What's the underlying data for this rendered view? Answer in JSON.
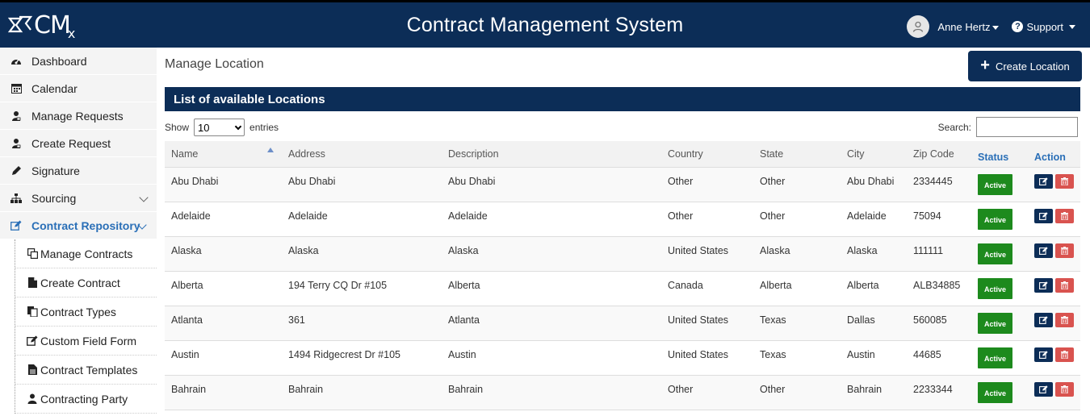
{
  "header": {
    "logo_text": "CM",
    "logo_sub": "x",
    "title": "Contract Management System",
    "user_name": "Anne Hertz",
    "support_label": "Support"
  },
  "sidebar": {
    "items": [
      {
        "label": "Dashboard",
        "icon": "dashboard-icon"
      },
      {
        "label": "Calendar",
        "icon": "calendar-icon"
      },
      {
        "label": "Manage Requests",
        "icon": "user-request-icon"
      },
      {
        "label": "Create Request",
        "icon": "user-request-icon"
      },
      {
        "label": "Signature",
        "icon": "pencil-icon"
      },
      {
        "label": "Sourcing",
        "icon": "sitemap-icon"
      },
      {
        "label": "Contract Repository",
        "icon": "edit-icon"
      }
    ],
    "subitems": [
      {
        "label": "Manage Contracts",
        "icon": "copy-icon"
      },
      {
        "label": "Create Contract",
        "icon": "file-icon"
      },
      {
        "label": "Contract Types",
        "icon": "files-icon"
      },
      {
        "label": "Custom Field Form",
        "icon": "edit-icon"
      },
      {
        "label": "Contract Templates",
        "icon": "file-text-icon"
      },
      {
        "label": "Contracting Party",
        "icon": "user-icon"
      }
    ]
  },
  "main": {
    "page_title": "Manage Location",
    "create_button_label": "Create Location",
    "panel_title": "List of available Locations",
    "show_label": "Show",
    "entries_label": "entries",
    "page_size": "10",
    "search_label": "Search:",
    "search_value": ""
  },
  "table": {
    "columns": [
      "Name",
      "Address",
      "Description",
      "Country",
      "State",
      "City",
      "Zip Code",
      "Status",
      "Action"
    ],
    "rows": [
      {
        "name": "Abu Dhabi",
        "address": "Abu Dhabi",
        "description": "Abu Dhabi",
        "country": "Other",
        "state": "Other",
        "city": "Abu Dhabi",
        "zip": "2334445",
        "status": "Active"
      },
      {
        "name": "Adelaide",
        "address": "Adelaide",
        "description": "Adelaide",
        "country": "Other",
        "state": "Other",
        "city": "Adelaide",
        "zip": "75094",
        "status": "Active"
      },
      {
        "name": "Alaska",
        "address": "Alaska",
        "description": "Alaska",
        "country": "United States",
        "state": "Alaska",
        "city": "Alaska",
        "zip": "111111",
        "status": "Active"
      },
      {
        "name": "Alberta",
        "address": "194 Terry CQ Dr #105",
        "description": "Alberta",
        "country": "Canada",
        "state": "Alberta",
        "city": "Alberta",
        "zip": "ALB34885",
        "status": "Active"
      },
      {
        "name": "Atlanta",
        "address": "361",
        "description": "Atlanta",
        "country": "United States",
        "state": "Texas",
        "city": "Dallas",
        "zip": "560085",
        "status": "Active"
      },
      {
        "name": "Austin",
        "address": "1494 Ridgecrest Dr #105",
        "description": "Austin",
        "country": "United States",
        "state": "Texas",
        "city": "Austin",
        "zip": "44685",
        "status": "Active"
      },
      {
        "name": "Bahrain",
        "address": "Bahrain",
        "description": "Bahrain",
        "country": "Other",
        "state": "Other",
        "city": "Bahrain",
        "zip": "2233344",
        "status": "Active"
      }
    ]
  },
  "colors": {
    "primary": "#0c2d57",
    "accent": "#2a6fb7",
    "active_badge": "#1d8a1d",
    "delete": "#d9534f"
  }
}
